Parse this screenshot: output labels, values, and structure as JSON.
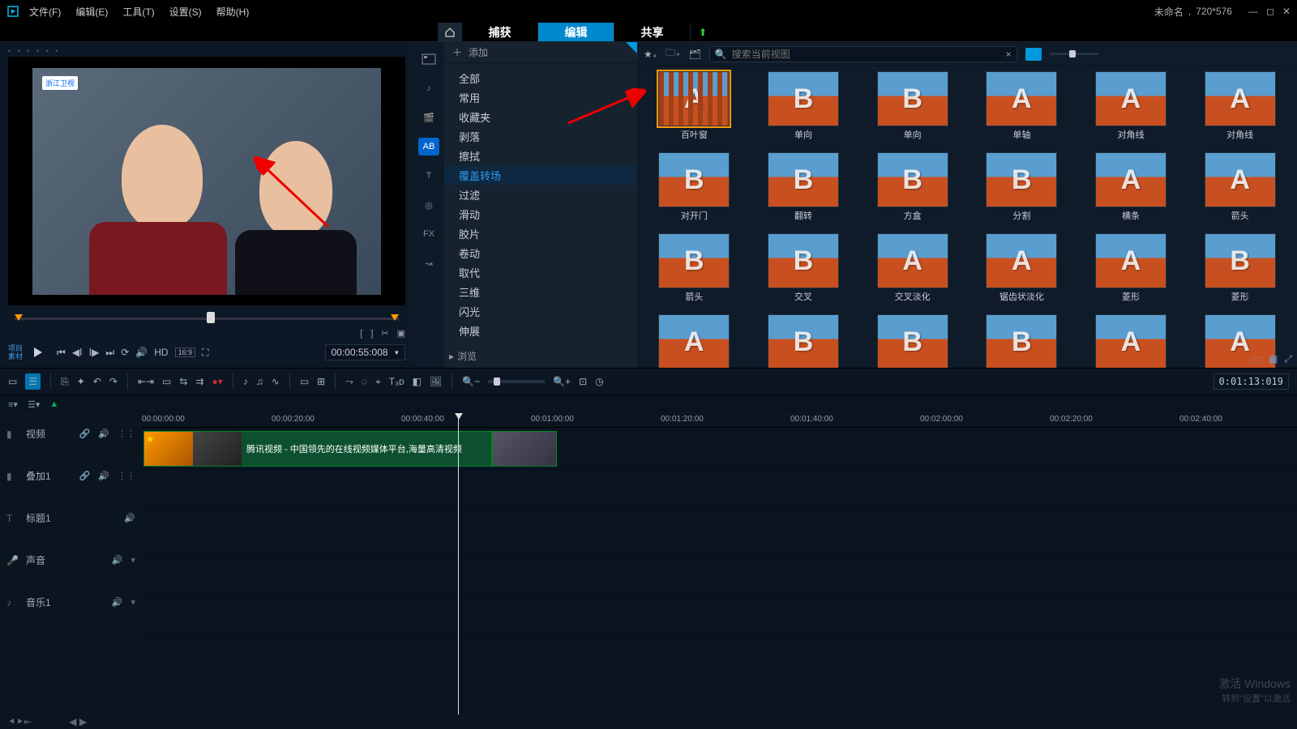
{
  "title_unsaved": "未命名",
  "resolution": "720*576",
  "menus": [
    "文件(F)",
    "编辑(E)",
    "工具(T)",
    "设置(S)",
    "帮助(H)"
  ],
  "main_tabs": [
    "捕获",
    "编辑",
    "共享"
  ],
  "active_main_tab": 1,
  "preview": {
    "watermark": "浙江卫视",
    "project_label": "项目",
    "material_label": "素材",
    "hd_label": "HD",
    "aspect_label": "16:9",
    "timecode": "00:00:55:008",
    "scrub_brackets": [
      "[",
      "]"
    ],
    "scissors": "✂"
  },
  "library": {
    "add_label": "添加",
    "categories": [
      "全部",
      "常用",
      "收藏夹",
      "剥落",
      "擦拭",
      "覆盖转场",
      "过滤",
      "滑动",
      "胶片",
      "卷动",
      "取代",
      "三维",
      "闪光",
      "伸展"
    ],
    "selected_category_index": 5,
    "bottom_link": "浏览",
    "search_placeholder": "搜索当前视图",
    "items": [
      {
        "label": "百叶窗",
        "letter": "A",
        "sel": true,
        "stripes": true
      },
      {
        "label": "单向",
        "letter": "B"
      },
      {
        "label": "单向",
        "letter": "B"
      },
      {
        "label": "单轴",
        "letter": "A"
      },
      {
        "label": "对角线",
        "letter": "A"
      },
      {
        "label": "对角线",
        "letter": "A"
      },
      {
        "label": "对开门",
        "letter": "B"
      },
      {
        "label": "翻转",
        "letter": "B"
      },
      {
        "label": "方盒",
        "letter": "B"
      },
      {
        "label": "分割",
        "letter": "B"
      },
      {
        "label": "横条",
        "letter": "A"
      },
      {
        "label": "箭头",
        "letter": "A"
      },
      {
        "label": "箭头",
        "letter": "B"
      },
      {
        "label": "交叉",
        "letter": "B"
      },
      {
        "label": "交叉淡化",
        "letter": "A"
      },
      {
        "label": "锯齿状淡化",
        "letter": "A"
      },
      {
        "label": "菱形",
        "letter": "A"
      },
      {
        "label": "菱形",
        "letter": "B"
      },
      {
        "label": "",
        "letter": "A"
      },
      {
        "label": "",
        "letter": "B"
      },
      {
        "label": "",
        "letter": "B"
      },
      {
        "label": "",
        "letter": "B"
      },
      {
        "label": "",
        "letter": "A"
      },
      {
        "label": "",
        "letter": "A"
      }
    ]
  },
  "timeline": {
    "timecode": "0:01:13:019",
    "ruler": [
      "00:00:00:00",
      "00:00:20:00",
      "00:00:40:00",
      "00:01:00:00",
      "00:01:20:00",
      "00:01:40:00",
      "00:02:00:00",
      "00:02:20:00",
      "00:02:40:00"
    ],
    "tracks": [
      {
        "name": "视频",
        "icons": [
          "link",
          "vol",
          "grid"
        ]
      },
      {
        "name": "叠加1",
        "icons": [
          "link",
          "vol",
          "grid"
        ]
      },
      {
        "name": "标题1",
        "icons": [
          "vol"
        ]
      },
      {
        "name": "声音",
        "icons": [
          "vol",
          "chev"
        ]
      },
      {
        "name": "音乐1",
        "icons": [
          "vol",
          "chev"
        ]
      }
    ],
    "clip_label": "腾讯视频 - 中国领先的在线视频媒体平台,海量高清视频"
  },
  "os_watermark": [
    "激活 Windows",
    "转到\"设置\"以激活"
  ]
}
